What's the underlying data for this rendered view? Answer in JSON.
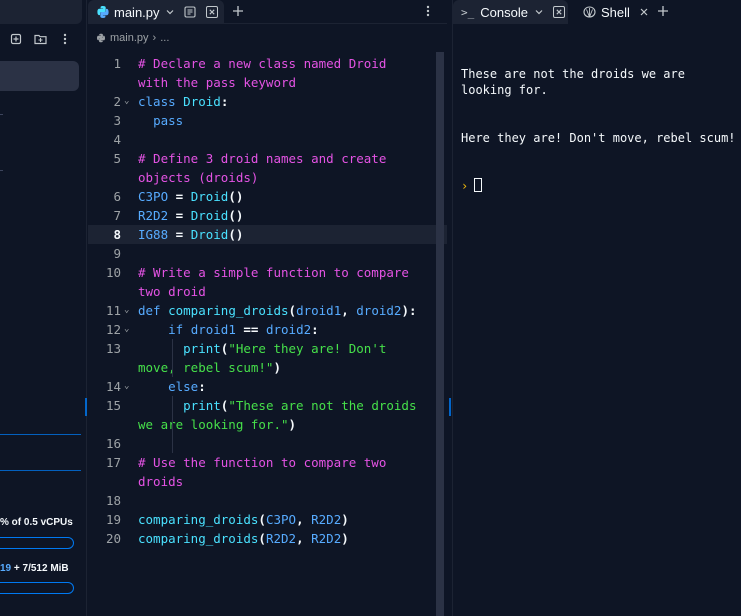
{
  "sidebar": {
    "stats": {
      "cpu_text": "% of 0.5 vCPUs",
      "mem_highlight": "19",
      "mem_text": " + 7/512 MiB"
    }
  },
  "editor": {
    "tab_label": "main.py",
    "breadcrumb_file": "main.py",
    "breadcrumb_sep": "›",
    "breadcrumb_more": "...",
    "lines": [
      {
        "n": "1",
        "t": "# Declare a new class named Droid",
        "cls": "c-com"
      },
      {
        "n": "",
        "t": "with the pass keyword",
        "cls": "c-com"
      },
      {
        "n": "2",
        "t": "class Droid:",
        "cls": "c-kw",
        "fold": "⌄"
      },
      {
        "n": "3",
        "t": "  pass",
        "cls": "c-kw"
      },
      {
        "n": "4",
        "t": "",
        "cls": "c-txt"
      },
      {
        "n": "5",
        "t": "# Define 3 droid names and create",
        "cls": "c-com"
      },
      {
        "n": "",
        "t": "objects (droids)",
        "cls": "c-com"
      },
      {
        "n": "6",
        "t": "C3PO = Droid()",
        "cls": "c-kw"
      },
      {
        "n": "7",
        "t": "R2D2 = Droid()",
        "cls": "c-kw"
      },
      {
        "n": "8",
        "t": "IG88 = Droid()",
        "cls": "c-kw",
        "active": true
      },
      {
        "n": "9",
        "t": "",
        "cls": "c-txt"
      },
      {
        "n": "10",
        "t": "# Write a simple function to compare",
        "cls": "c-com"
      },
      {
        "n": "",
        "t": "two droid",
        "cls": "c-com"
      },
      {
        "n": "11",
        "t": "def comparing_droids(droid1, droid2):",
        "cls": "c-kw",
        "fold": "⌄"
      },
      {
        "n": "12",
        "t": "    if droid1 == droid2:",
        "cls": "c-kw",
        "fold": "⌄"
      },
      {
        "n": "13",
        "t": "      print(\"Here they are! Don't",
        "cls": "c-str"
      },
      {
        "n": "",
        "t": "move, rebel scum!\")",
        "cls": "c-str"
      },
      {
        "n": "14",
        "t": "    else:",
        "cls": "c-kw",
        "fold": "⌄"
      },
      {
        "n": "15",
        "t": "      print(\"These are not the droids",
        "cls": "c-str"
      },
      {
        "n": "",
        "t": "we are looking for.\")",
        "cls": "c-str"
      },
      {
        "n": "16",
        "t": "",
        "cls": "c-txt"
      },
      {
        "n": "17",
        "t": "# Use the function to compare two",
        "cls": "c-com"
      },
      {
        "n": "",
        "t": "droids",
        "cls": "c-com"
      },
      {
        "n": "18",
        "t": "",
        "cls": "c-txt"
      },
      {
        "n": "19",
        "t": "comparing_droids(C3PO, R2D2)",
        "cls": "c-kw"
      },
      {
        "n": "20",
        "t": "comparing_droids(R2D2, R2D2)",
        "cls": "c-kw"
      }
    ]
  },
  "console": {
    "tab_console": "Console",
    "tab_shell": "Shell",
    "output_line1": "These are not the droids we are looking for.",
    "output_line2": "Here they are! Don't move, rebel scum!",
    "prompt": "›"
  },
  "colors": {
    "accent": "#0079f2",
    "comment": "#e453e4",
    "keyword": "#57abff",
    "function": "#4ae1ff",
    "string": "#46e04a"
  }
}
